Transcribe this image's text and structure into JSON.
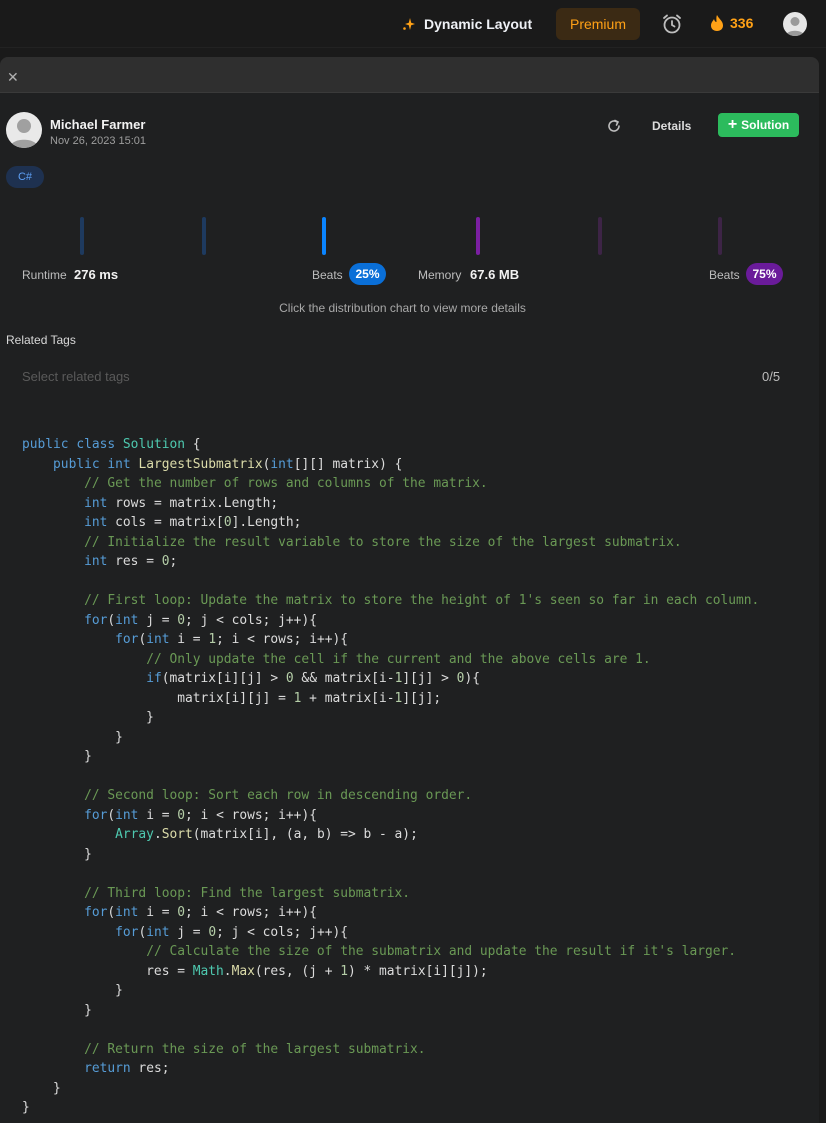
{
  "nav": {
    "dynamic_layout": "Dynamic Layout",
    "premium": "Premium",
    "streak": "336"
  },
  "submission": {
    "author": "Michael Farmer",
    "date": "Nov 26, 2023 15:01",
    "details": "Details",
    "solution": "Solution",
    "language": "C#"
  },
  "stats": {
    "runtime_label": "Runtime",
    "runtime_value": "276 ms",
    "runtime_beats_label": "Beats",
    "runtime_beats": "25%",
    "memory_label": "Memory",
    "memory_value": "67.6 MB",
    "memory_beats_label": "Beats",
    "memory_beats": "75%",
    "hint": "Click the distribution chart to view more details"
  },
  "tags": {
    "title": "Related Tags",
    "placeholder": "Select related tags",
    "count": "0/5"
  },
  "colors": {
    "accent_orange": "#ffa116",
    "accent_green": "#2cbb5d",
    "runtime_blue": "#0a84ff",
    "memory_purple": "#7b1fa2"
  },
  "code_lines": [
    "public class Solution {",
    "    public int LargestSubmatrix(int[][] matrix) {",
    "        // Get the number of rows and columns of the matrix.",
    "        int rows = matrix.Length;",
    "        int cols = matrix[0].Length;",
    "        // Initialize the result variable to store the size of the largest submatrix.",
    "        int res = 0;",
    "",
    "        // First loop: Update the matrix to store the height of 1's seen so far in each column.",
    "        for(int j = 0; j < cols; j++){",
    "            for(int i = 1; i < rows; i++){",
    "                // Only update the cell if the current and the above cells are 1.",
    "                if(matrix[i][j] > 0 && matrix[i-1][j] > 0){",
    "                    matrix[i][j] = 1 + matrix[i-1][j];",
    "                }",
    "            }",
    "        }",
    "",
    "        // Second loop: Sort each row in descending order.",
    "        for(int i = 0; i < rows; i++){",
    "            Array.Sort(matrix[i], (a, b) => b - a);",
    "        }",
    "",
    "        // Third loop: Find the largest submatrix.",
    "        for(int i = 0; i < rows; i++){",
    "            for(int j = 0; j < cols; j++){",
    "                // Calculate the size of the submatrix and update the result if it's larger.",
    "                res = Math.Max(res, (j + 1) * matrix[i][j]);",
    "            }",
    "        }",
    "",
    "        // Return the size of the largest submatrix.",
    "        return res;",
    "    }",
    "}"
  ]
}
